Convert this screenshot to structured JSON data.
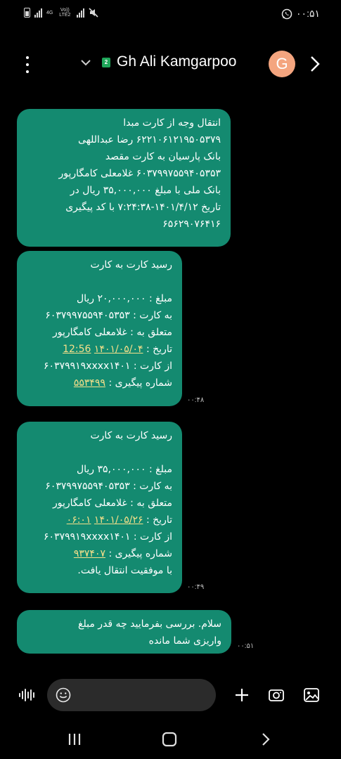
{
  "status_bar": {
    "time": "۰۰:۵۱",
    "network_1": "4G",
    "network_2": "Vo)) LTE2",
    "icons": [
      "battery-icon",
      "signal-icon",
      "signal-icon",
      "mute-icon",
      "whatsapp-icon"
    ]
  },
  "header": {
    "contact_name": "Gh Ali Kamgarpoo",
    "sim_badge": "2",
    "avatar_letter": "G",
    "avatar_color": "#f4a57f",
    "icons": [
      "more-vert-icon",
      "chevron-down-icon",
      "chevron-right-icon"
    ]
  },
  "messages": [
    {
      "lines": [
        "انتقال وجه از کارت مبدا",
        "۶۲۲۱۰۶۱۲۱۹۵۰۵۳۷۹ رضا عبداللهی",
        "بانک پارسیان به کارت مقصد",
        "۶۰۳۷۹۹۷۵۵۹۴۰۵۳۵۳ غلامعلی کامگارپور",
        "بانک ملی با مبلغ ۳۵,۰۰۰,۰۰۰ ریال در",
        "تاریخ ۱۴۰۱/۴/۱۲-۷:۲۴:۳۸ با کد پیگیری",
        "۶۵۶۲۹۰۷۶۴۱۶"
      ],
      "time": ""
    },
    {
      "title": "رسید کارت به کارت",
      "amount": "مبلغ : ۲۰,۰۰۰,۰۰۰ ریال",
      "to_card": "به کارت : ۶۰۳۷۹۹۷۵۵۹۴۰۵۳۵۳",
      "owner": "متعلق به : غلامعلی کامگارپور",
      "date_label": "تاریخ :",
      "date_link": "۱۴۰۱/۰۵/۰۴",
      "time_link": "12:56",
      "from_card": "از کارت : ۶۰۳۷۹۹۱۹xxxx۱۴۰۱",
      "tracking_label": "شماره پیگیری :",
      "tracking_link": "۵۵۳۴۹۹",
      "time": "۰۰:۴۸"
    },
    {
      "title": "رسید کارت به کارت",
      "amount": "مبلغ : ۳۵,۰۰۰,۰۰۰ ریال",
      "to_card": "به کارت : ۶۰۳۷۹۹۷۵۵۹۴۰۵۳۵۳",
      "owner": "متعلق به : غلامعلی کامگارپور",
      "date_label": "تاریخ :",
      "date_link": "۱۴۰۱/۰۵/۲۶",
      "time_link": "۰۶:۰۱",
      "from_card": "از کارت : ۶۰۳۷۹۹۱۹xxxx۱۴۰۱",
      "tracking_label": "شماره پیگیری :",
      "tracking_link": "۹۳۷۴۰۷",
      "result": "با موفقیت انتقال یافت.",
      "time": "۰۰:۴۹"
    },
    {
      "lines": [
        "سلام. بررسی بفرمایید چه قدر مبلغ",
        "واریزی شما مانده"
      ],
      "time": "۰۰:۵۱"
    }
  ],
  "composer": {
    "placeholder": "",
    "icons": [
      "voice-icon",
      "emoji-icon",
      "plus-icon",
      "camera-icon",
      "gallery-icon"
    ]
  },
  "nav_bar": {
    "icons": [
      "recents-icon",
      "home-icon",
      "back-icon"
    ]
  },
  "colors": {
    "bubble": "#148a70",
    "link": "#f6e08a",
    "background": "#000000"
  }
}
